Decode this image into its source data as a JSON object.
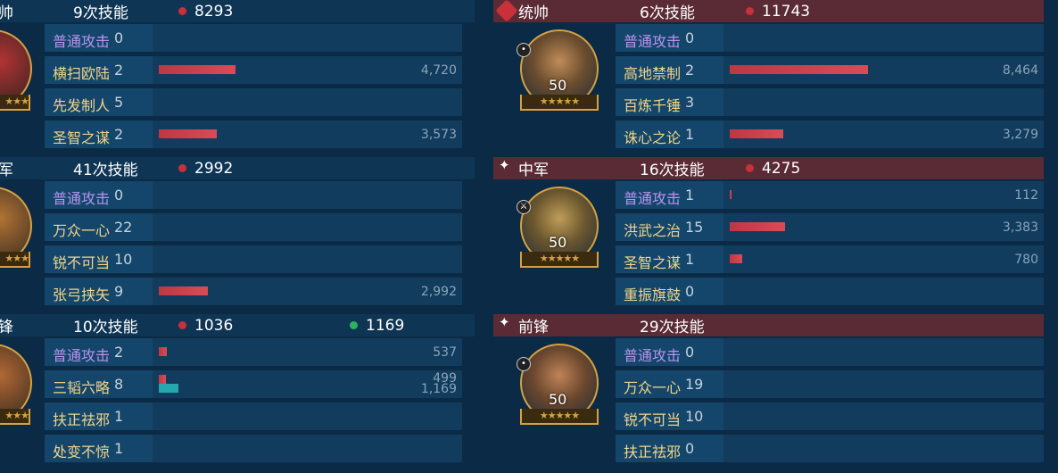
{
  "left": {
    "groups": [
      {
        "role": "帅",
        "casts": "9次技能",
        "damage": "8293",
        "skills": [
          {
            "name": "普通攻击",
            "count": "0",
            "basic": true,
            "bar": 0,
            "value": ""
          },
          {
            "name": "横扫欧陆",
            "count": "2",
            "basic": false,
            "bar": 86,
            "value": "4,720"
          },
          {
            "name": "先发制人",
            "count": "5",
            "basic": false,
            "bar": 0,
            "value": ""
          },
          {
            "name": "圣智之谋",
            "count": "2",
            "basic": false,
            "bar": 65,
            "value": "3,573"
          }
        ],
        "stars": "★★★"
      },
      {
        "role": "军",
        "casts": "41次技能",
        "damage": "2992",
        "skills": [
          {
            "name": "普通攻击",
            "count": "0",
            "basic": true,
            "bar": 0,
            "value": ""
          },
          {
            "name": "万众一心",
            "count": "22",
            "basic": false,
            "bar": 0,
            "value": ""
          },
          {
            "name": "锐不可当",
            "count": "10",
            "basic": false,
            "bar": 0,
            "value": ""
          },
          {
            "name": "张弓挟矢",
            "count": "9",
            "basic": false,
            "bar": 55,
            "value": "2,992"
          }
        ],
        "stars": "★★★"
      },
      {
        "role": "锋",
        "casts": "10次技能",
        "damage": "1036",
        "heal": "1169",
        "skills": [
          {
            "name": "普通攻击",
            "count": "2",
            "basic": true,
            "bar": 9,
            "value": "537"
          },
          {
            "name": "三韬六略",
            "count": "8",
            "basic": false,
            "bar": 8,
            "bar2": 22,
            "value": "499",
            "value2": "1,169"
          },
          {
            "name": "扶正祛邪",
            "count": "1",
            "basic": false,
            "bar": 0,
            "value": ""
          },
          {
            "name": "处变不惊",
            "count": "1",
            "basic": false,
            "bar": 0,
            "value": ""
          }
        ],
        "stars": "★★★"
      }
    ]
  },
  "right": {
    "groups": [
      {
        "role": "统帅",
        "casts": "6次技能",
        "damage": "11743",
        "level": "50",
        "stars": "★★★★★",
        "skills": [
          {
            "name": "普通攻击",
            "count": "0",
            "basic": true,
            "bar": 0,
            "value": ""
          },
          {
            "name": "高地禁制",
            "count": "2",
            "basic": false,
            "bar": 155,
            "value": "8,464"
          },
          {
            "name": "百炼千锤",
            "count": "3",
            "basic": false,
            "bar": 0,
            "value": ""
          },
          {
            "name": "诛心之论",
            "count": "1",
            "basic": false,
            "bar": 60,
            "value": "3,279"
          }
        ]
      },
      {
        "role": "中军",
        "casts": "16次技能",
        "damage": "4275",
        "level": "50",
        "stars": "★★★★★",
        "skills": [
          {
            "name": "普通攻击",
            "count": "1",
            "basic": true,
            "bar": 2,
            "value": "112"
          },
          {
            "name": "洪武之治",
            "count": "15",
            "basic": false,
            "bar": 62,
            "value": "3,383"
          },
          {
            "name": "圣智之谋",
            "count": "1",
            "basic": false,
            "bar": 14,
            "value": "780"
          },
          {
            "name": "重振旗鼓",
            "count": "0",
            "basic": false,
            "bar": 0,
            "value": ""
          }
        ]
      },
      {
        "role": "前锋",
        "casts": "29次技能",
        "level": "50",
        "stars": "★★★★★",
        "skills": [
          {
            "name": "普通攻击",
            "count": "0",
            "basic": true,
            "bar": 0,
            "value": ""
          },
          {
            "name": "万众一心",
            "count": "19",
            "basic": false,
            "bar": 0,
            "value": ""
          },
          {
            "name": "锐不可当",
            "count": "10",
            "basic": false,
            "bar": 0,
            "value": ""
          },
          {
            "name": "扶正祛邪",
            "count": "0",
            "basic": false,
            "bar": 0,
            "value": ""
          }
        ]
      }
    ]
  },
  "colors": {
    "damage_dot": "#c8303a",
    "heal_dot": "#2fb35a",
    "bar": "#c8303a",
    "bar_heal": "#26a7b0",
    "basic_skill": "#b894ee",
    "skill": "#f0d589"
  }
}
